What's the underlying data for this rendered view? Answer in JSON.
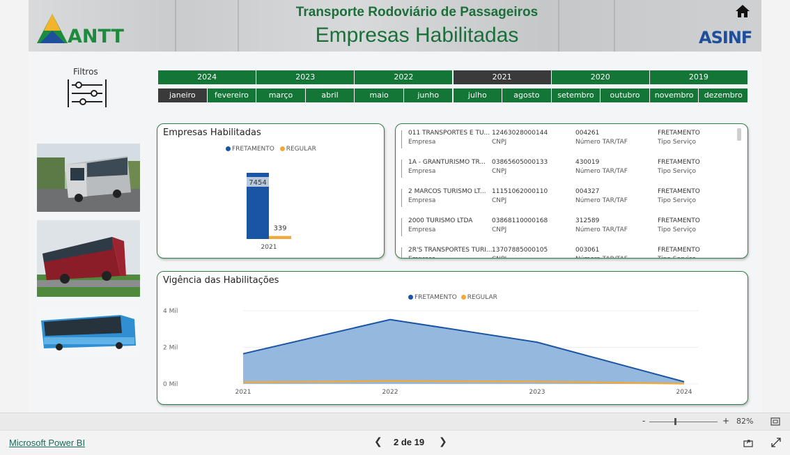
{
  "header": {
    "title": "Transporte Rodoviário de Passageiros",
    "subtitle": "Empresas Habilitadas",
    "logo_text": "ANTT",
    "asinf_text": "ASINF",
    "home_icon": "home-icon"
  },
  "filters": {
    "label": "Filtros",
    "icon": "sliders-icon",
    "years": [
      {
        "label": "2024",
        "selected": false
      },
      {
        "label": "2023",
        "selected": false
      },
      {
        "label": "2022",
        "selected": false
      },
      {
        "label": "2021",
        "selected": true
      },
      {
        "label": "2020",
        "selected": false
      },
      {
        "label": "2019",
        "selected": false
      }
    ],
    "months": [
      {
        "label": "janeiro",
        "selected": true
      },
      {
        "label": "fevereiro",
        "selected": false
      },
      {
        "label": "março",
        "selected": false
      },
      {
        "label": "abril",
        "selected": false
      },
      {
        "label": "maio",
        "selected": false
      },
      {
        "label": "junho",
        "selected": false
      },
      {
        "label": "julho",
        "selected": false
      },
      {
        "label": "agosto",
        "selected": false
      },
      {
        "label": "setembro",
        "selected": false
      },
      {
        "label": "outubro",
        "selected": false
      },
      {
        "label": "novembro",
        "selected": false
      },
      {
        "label": "dezembro",
        "selected": false
      }
    ]
  },
  "bar_card": {
    "title": "Empresas Habilitadas",
    "legend": [
      "FRETAMENTO",
      "REGULAR"
    ]
  },
  "companies": {
    "rows": [
      {
        "empresa": "011 TRANSPORTES E TU...",
        "cnpj": "12463028000144",
        "tar": "004261",
        "tipo": "FRETAMENTO"
      },
      {
        "empresa": "1A - GRANTURISMO TR...",
        "cnpj": "03865605000133",
        "tar": "430019",
        "tipo": "FRETAMENTO"
      },
      {
        "empresa": "2 MARCOS TURISMO LT...",
        "cnpj": "11151062000110",
        "tar": "004327",
        "tipo": "FRETAMENTO"
      },
      {
        "empresa": "2000 TURISMO LTDA",
        "cnpj": "03868110000168",
        "tar": "312589",
        "tipo": "FRETAMENTO"
      },
      {
        "empresa": "2R'S TRANSPORTES TURI...",
        "cnpj": "13707885000105",
        "tar": "003061",
        "tipo": "FRETAMENTO"
      }
    ],
    "sublabels": {
      "empresa": "Empresa",
      "cnpj": "CNPJ",
      "tar": "Número TAR/TAF",
      "tipo": "Tipo Serviço"
    }
  },
  "area_card": {
    "title": "Vigência das Habilitações",
    "legend": [
      "FRETAMENTO",
      "REGULAR"
    ]
  },
  "colors": {
    "green": "#137636",
    "fretamento": "#1a55a3",
    "regular": "#f2a93b",
    "area_fill": "#8eb4dc"
  },
  "chart_data": [
    {
      "type": "bar",
      "title": "Empresas Habilitadas",
      "categories": [
        "2021"
      ],
      "series": [
        {
          "name": "FRETAMENTO",
          "values": [
            7454
          ]
        },
        {
          "name": "REGULAR",
          "values": [
            339
          ]
        }
      ],
      "data_labels": [
        "7454",
        "339"
      ],
      "legend": "top-center"
    },
    {
      "type": "area",
      "title": "Vigência das Habilitações",
      "x": [
        "2021",
        "2022",
        "2023",
        "2024"
      ],
      "series": [
        {
          "name": "FRETAMENTO",
          "values": [
            1650,
            3520,
            2280,
            120
          ]
        },
        {
          "name": "REGULAR",
          "values": [
            90,
            160,
            130,
            20
          ]
        }
      ],
      "yticks": [
        "0 Mil",
        "2 Mil",
        "4 Mil"
      ],
      "ylim": [
        0,
        4000
      ],
      "legend": "top-center"
    }
  ],
  "footer": {
    "powerbi_link": "Microsoft Power BI",
    "page": "2 de 19",
    "zoom": "82%",
    "zoom_minus": "-",
    "zoom_plus": "+"
  }
}
